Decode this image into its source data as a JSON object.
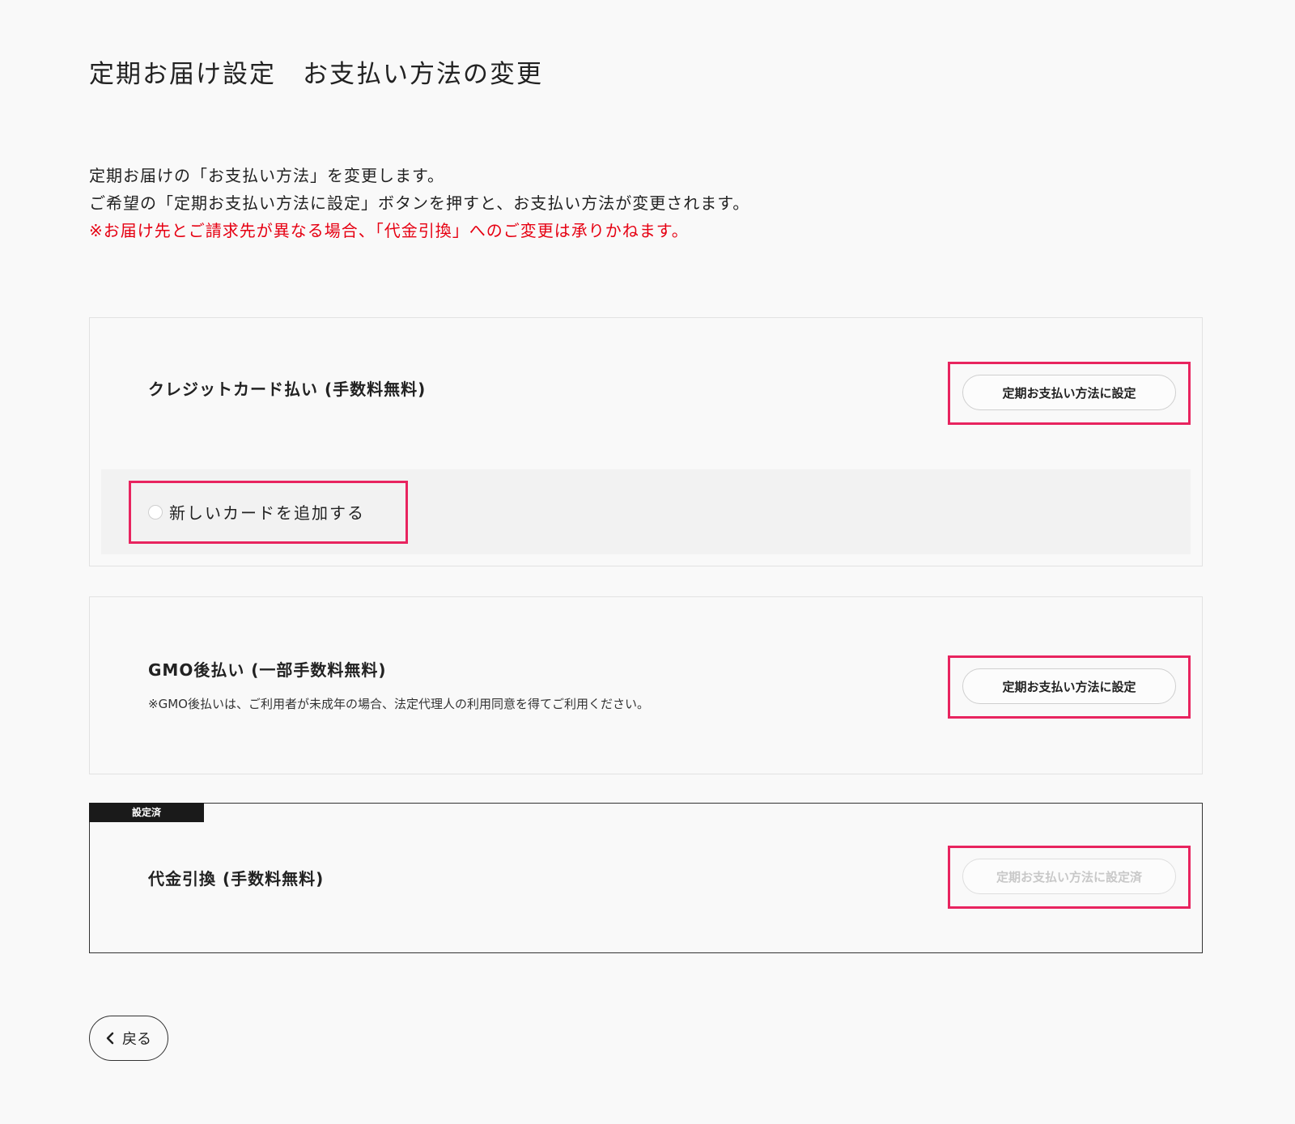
{
  "page_title": "定期お届け設定　お支払い方法の変更",
  "intro": {
    "line1": "定期お届けの「お支払い方法」を変更します。",
    "line2": "ご希望の「定期お支払い方法に設定」ボタンを押すと、お支払い方法が変更されます。",
    "warning": "※お届け先とご請求先が異なる場合、「代金引換」へのご変更は承りかねます。"
  },
  "payment_methods": [
    {
      "title": "クレジットカード払い (手数料無料)",
      "button_label": "定期お支払い方法に設定",
      "add_card_option": "新しいカードを追加する",
      "add_card_selected": false
    },
    {
      "title": "GMO後払い (一部手数料無料)",
      "note": "※GMO後払いは、ご利用者が未成年の場合、法定代理人の利用同意を得てご利用ください。",
      "button_label": "定期お支払い方法に設定"
    },
    {
      "badge": "設定済",
      "title": "代金引換 (手数料無料)",
      "button_label": "定期お支払い方法に設定済",
      "button_disabled": true
    }
  ],
  "back_button": {
    "label": "戻る",
    "icon": "chevron-left-icon"
  },
  "colors": {
    "background": "#f9f9f9",
    "warning_text": "#e60012",
    "highlight_border": "#e8245f",
    "badge_background": "#1a1a1a"
  }
}
